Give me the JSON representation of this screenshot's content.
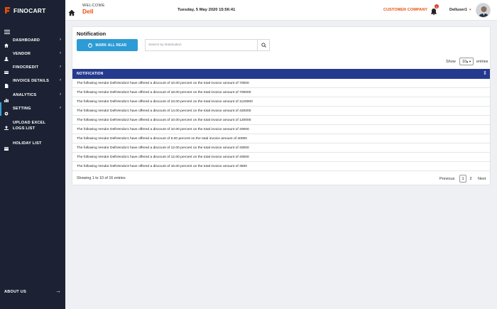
{
  "brand": {
    "name": "FINOCART",
    "accent": "#e8500e",
    "primary": "#2d9bd5",
    "table_header": "#243a8e",
    "sidebar_bg": "#1c2233"
  },
  "header": {
    "welcome": "WELCOME",
    "company": "Dell",
    "datetime": "Tuesday, 5 May 2020 15:56:41",
    "customer_company": "CUSTOMER COMPANY",
    "notification_count": "1",
    "user": "Delluser1",
    "user_caret": "▾"
  },
  "sidebar": {
    "items": [
      {
        "label": "DASHBOARD",
        "icon": "home-icon",
        "chevron": "›"
      },
      {
        "label": "VENDOR",
        "icon": "users-icon",
        "chevron": "›"
      },
      {
        "label": "FINOCREDIT",
        "icon": "card-icon",
        "chevron": "›"
      },
      {
        "label": "INVOICE DETAILS",
        "icon": "document-icon",
        "chevron": "›"
      },
      {
        "label": "ANALYTICS",
        "icon": "chart-icon",
        "chevron": "›"
      },
      {
        "label": "SETTING",
        "icon": "gear-icon",
        "chevron": "›"
      },
      {
        "label": "UPLOAD EXCEL LOGS LIST",
        "icon": "upload-icon",
        "chevron": ""
      },
      {
        "label": "HOLIDAY LIST",
        "icon": "calendar-icon",
        "chevron": ""
      }
    ],
    "about": "ABOUT US",
    "about_arrow": "→"
  },
  "main": {
    "title": "Notification",
    "mark_all_read": "MARK ALL READ",
    "search_placeholder": "Search by Notification",
    "show_label": "Show",
    "show_value": "10",
    "entries_label": "entries",
    "column_header": "NOTIFICATION",
    "rows": [
      "The following Vendor DellVendor2 have offered a discount of 10.00 percent on the total invoice amount of 70000",
      "The following Vendor DellVendor2 have offered a discount of 18.00 percent on the total invoice amount of 700000",
      "The following Vendor DellVendor1 have offered a discount of 23.00 percent on the total invoice amount of 1120000",
      "The following Vendor DellVendor1 have offered a discount of 14.00 percent on the total invoice amount of 420000",
      "The following Vendor DellVendor2 have offered a discount of 10.00 percent on the total invoice amount of 120000",
      "The following Vendor DellVendor1 have offered a discount of 10.00 percent on the total invoice amount of 40000",
      "The following Vendor DellVendor1 have offered a discount of 5.00 percent on the total invoice amount of 40000",
      "The following Vendor DellVendor1 have offered a discount of 12.00 percent on the total invoice amount of 40000",
      "The following Vendor DellVendor1 have offered a discount of 12.00 percent on the total invoice amount of 40000",
      "The following Vendor DellVendor3 have offered a discount of 16.00 percent on the total invoice amount of 3500"
    ],
    "info": "Showing 1 to 10 of 16 entries",
    "pagination": {
      "previous": "Previous",
      "pages": [
        "1",
        "2"
      ],
      "next": "Next"
    }
  }
}
